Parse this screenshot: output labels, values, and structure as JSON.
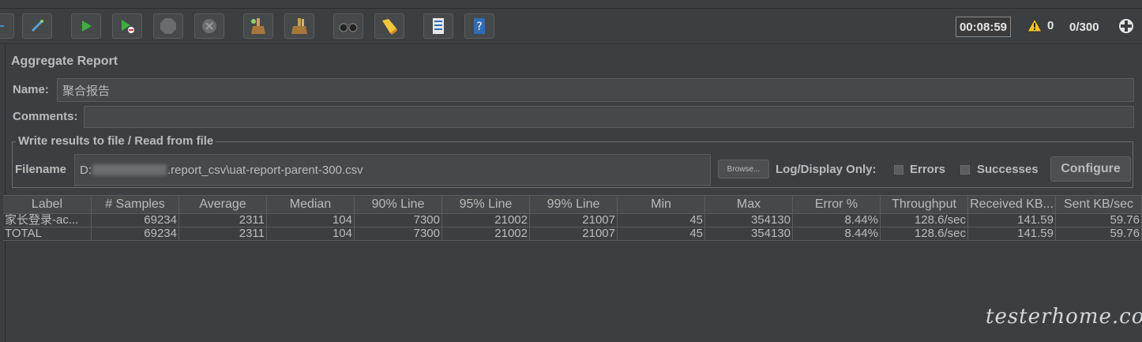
{
  "toolbar": {
    "timer": "00:08:59",
    "warnings": "0",
    "threads": "0/300"
  },
  "report": {
    "title": "Aggregate Report",
    "name_label": "Name:",
    "name_value": "聚合报告",
    "comments_label": "Comments:",
    "write_legend": "Write results to file / Read from file",
    "filename_label": "Filename",
    "filename_prefix": "D:",
    "filename_suffix": ".report_csv\\uat-report-parent-300.csv",
    "browse_label": "Browse...",
    "log_display_label": "Log/Display Only:",
    "errors_label": "Errors",
    "successes_label": "Successes",
    "configure_label": "Configure"
  },
  "table": {
    "columns": [
      "Label",
      "# Samples",
      "Average",
      "Median",
      "90% Line",
      "95% Line",
      "99% Line",
      "Min",
      "Max",
      "Error %",
      "Throughput",
      "Received KB...",
      "Sent KB/sec"
    ],
    "rows": [
      [
        "家长登录-ac...",
        "69234",
        "2311",
        "104",
        "7300",
        "21002",
        "21007",
        "45",
        "354130",
        "8.44%",
        "128.6/sec",
        "141.59",
        "59.76"
      ],
      [
        "TOTAL",
        "69234",
        "2311",
        "104",
        "7300",
        "21002",
        "21007",
        "45",
        "354130",
        "8.44%",
        "128.6/sec",
        "141.59",
        "59.76"
      ]
    ]
  },
  "watermark": "testerhome.com"
}
